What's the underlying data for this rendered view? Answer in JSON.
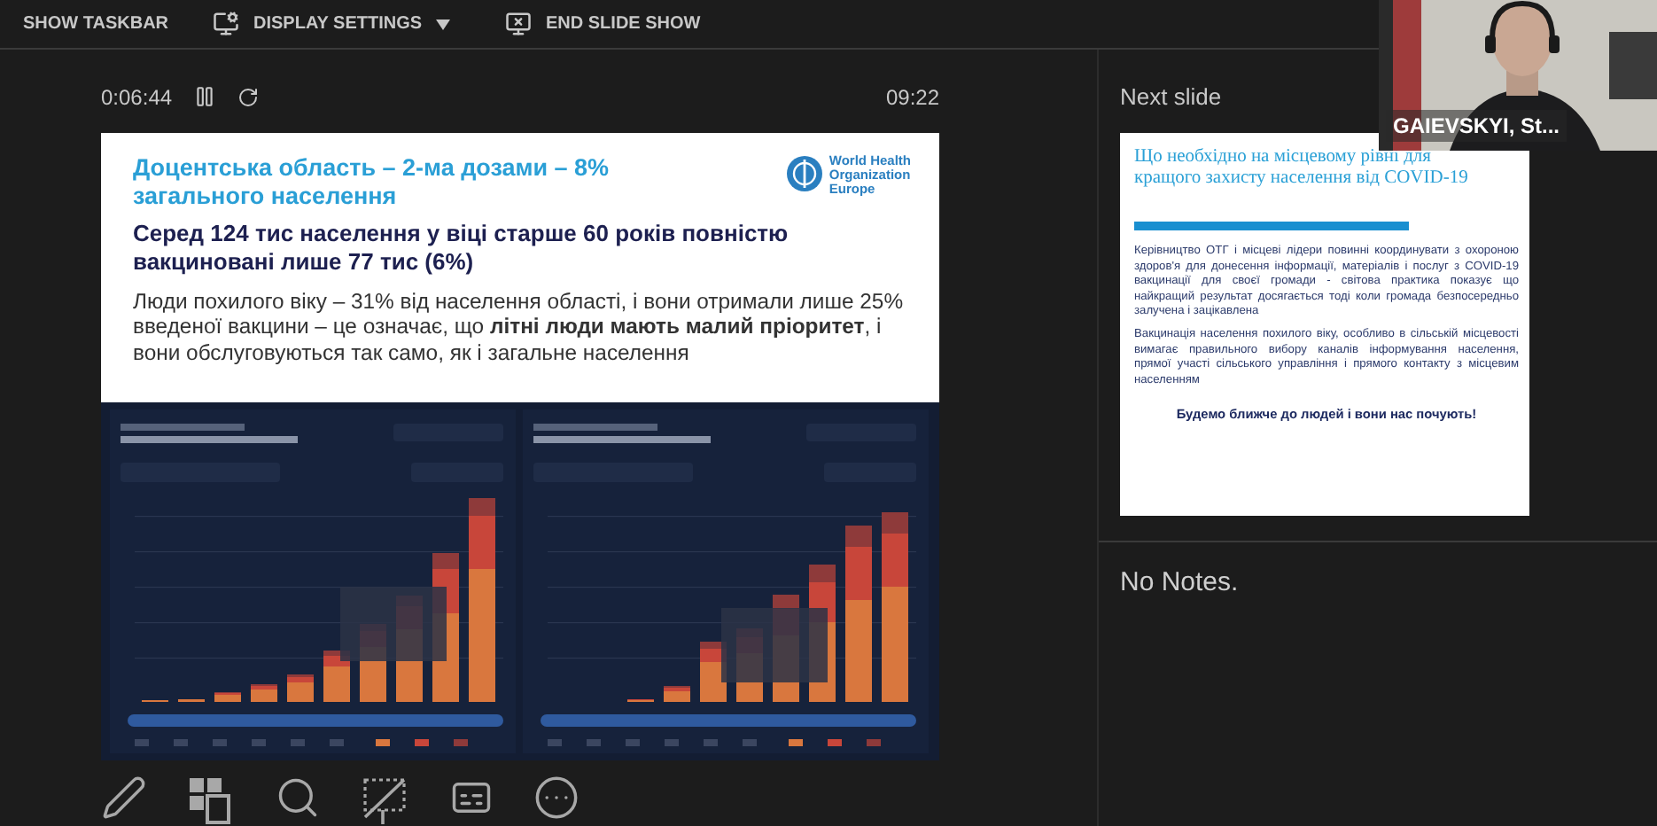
{
  "toolbar": {
    "items": [
      {
        "kind": "plain",
        "label": "SHOW TASKBAR"
      },
      {
        "kind": "display",
        "label": "DISPLAY SETTINGS",
        "dropdown": true
      },
      {
        "kind": "end",
        "label": "END SLIDE SHOW"
      }
    ]
  },
  "timer": {
    "elapsed": "0:06:44",
    "clock": "09:22"
  },
  "current_slide": {
    "title": "Доцентська область – 2-ма дозами – 8% загального населення",
    "logo": [
      "World Health",
      "Organization",
      "Europe"
    ],
    "subtitle": "Серед 124 тис населення у віці старше 60 років повністю вакциновані лише 77 тис (6%)",
    "body": "Люди похилого віку – 31% від населення області, і вони отримали лише 25% введеної вакцини – це означає, що **літні люди мають малий пріоритет**, і вони обслуговуються так само, як і загальне населення"
  },
  "next_slide": {
    "label": "Next slide",
    "title": "Що необхідно на місцевому рівні для кращого захисту населення від COVID-19",
    "paragraphs": [
      "Керівництво ОТГ і місцеві лідери повинні координувати з охороною здоров'я для донесення інформації, матеріалів і послуг з COVID-19 вакцинації для своєї громади - світова практика показує що найкращий результат досягається тоді коли громада безпосередньо залучена і зацікавлена",
      "Вакцинація населення похилого віку, особливо в сільській місцевості вимагає правильного вибору каналів інформування населення, прямої участі сільського управління і прямого контакту з місцевим населенням"
    ],
    "closing": "Будемо ближче до людей і вони нас почують!"
  },
  "notes": "No Notes.",
  "webcam": {
    "name": "GAIEVSKYI, St..."
  },
  "tools": [
    {
      "kind": "pen"
    },
    {
      "kind": "slides"
    },
    {
      "kind": "zoom"
    },
    {
      "kind": "laser"
    },
    {
      "kind": "subtitles"
    },
    {
      "kind": "more"
    }
  ]
}
